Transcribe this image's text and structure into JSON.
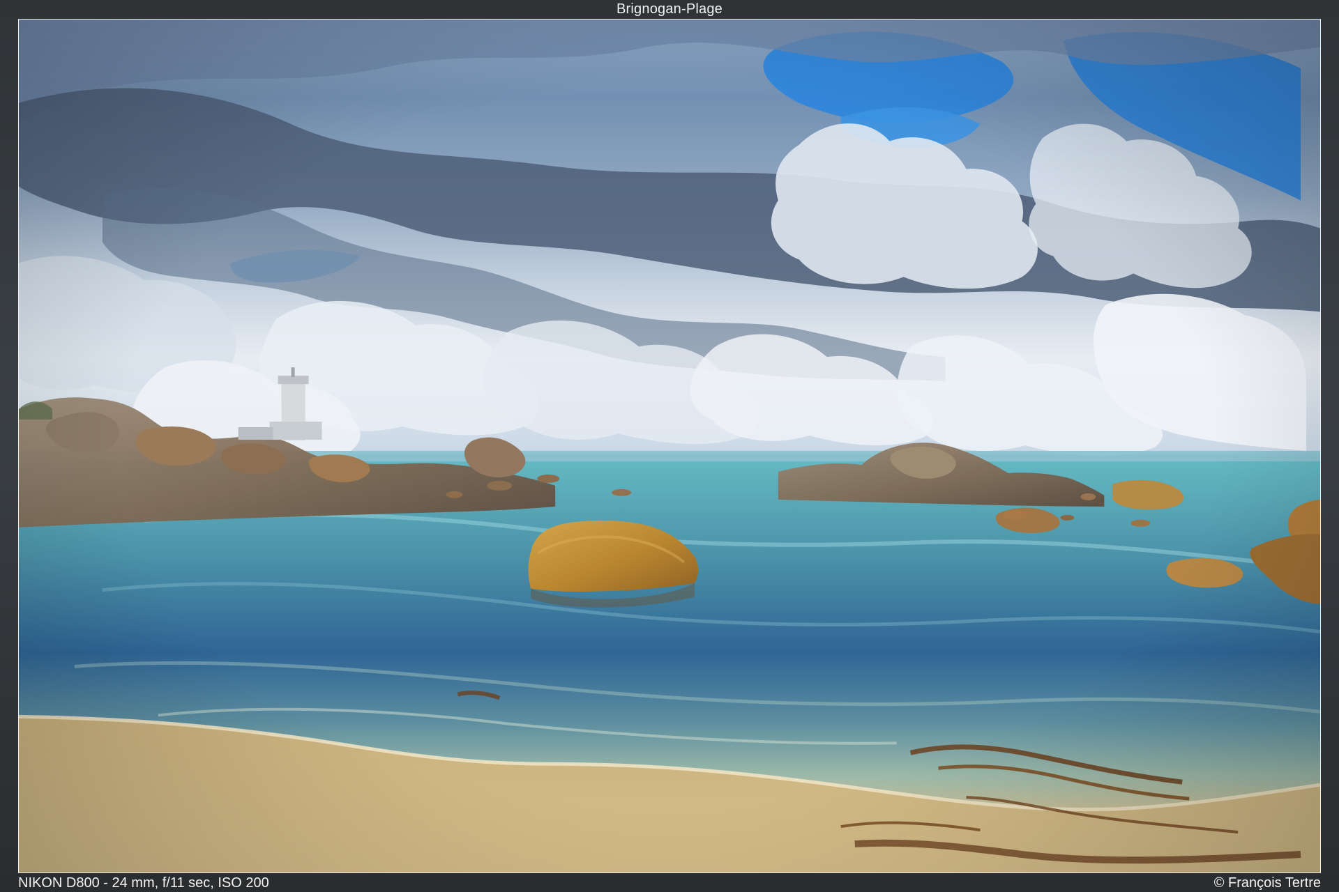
{
  "header": {
    "title": "Brignogan-Plage"
  },
  "photo": {
    "subject": "photo"
  },
  "footer": {
    "camera_info": "NIKON D800 - 24 mm, f/11 sec, ISO 200",
    "copyright": "© François Tertre"
  },
  "colors": {
    "sky_blue": "#3b8fe0",
    "cloud_dark": "#4d5f78",
    "cloud_light": "#dfe7f0",
    "sea_teal": "#57a3b2",
    "sea_blue": "#2f5f95",
    "sand": "#d6bf8b",
    "rock_gold": "#b9862f",
    "seaweed": "#6a3f1d"
  }
}
